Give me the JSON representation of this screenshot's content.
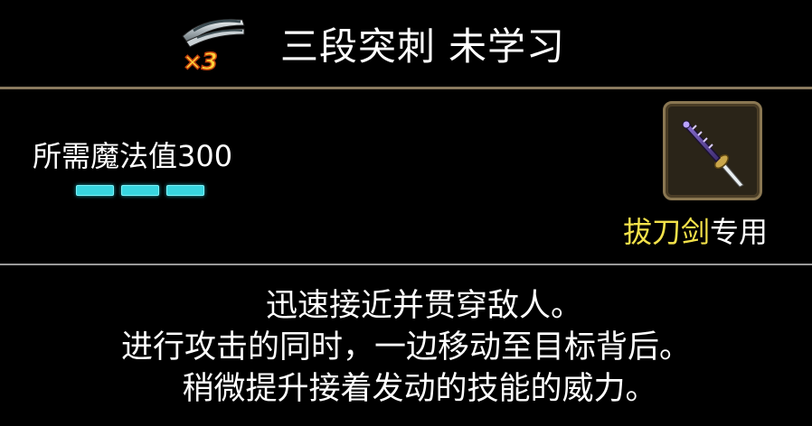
{
  "header": {
    "skill_icon": "triple-thrust-skill-icon",
    "multiplier": "×3",
    "skill_name": "三段突刺",
    "status": "未学习"
  },
  "requirement": {
    "mana_label": "所需魔法值300",
    "segments": 3,
    "segment_color": "#38d6e0"
  },
  "weapon": {
    "icon": "katana-icon",
    "type_name": "拔刀剑",
    "suffix": "专用",
    "highlight_color": "#f3e24a"
  },
  "description": {
    "lines": [
      "迅速接近并贯穿敌人。",
      "进行攻击的同时，一边移动至目标背后。",
      "稍微提升接着发动的技能的威力。"
    ]
  }
}
